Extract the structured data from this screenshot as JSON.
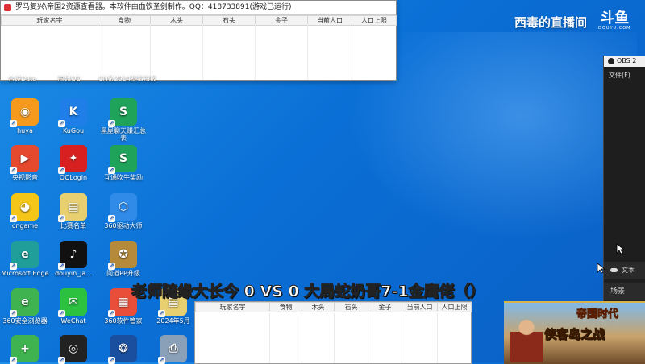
{
  "top_window": {
    "title": "罗马复兴\\帝国2资源查看器。本软件由血饮圣剑制作。QQ：418733891(游戏已运行)",
    "columns": [
      "玩家名字",
      "食物",
      "木头",
      "石头",
      "金子",
      "当前人口",
      "人口上限"
    ]
  },
  "desktop": {
    "partial_labels": [
      "合设Data",
      "腾讯QQ",
      "CN帝2024赛事海报"
    ],
    "icons": [
      {
        "label": "huya",
        "icon": "huya-icon",
        "color": "#f59a1c",
        "glyph": "◉"
      },
      {
        "label": "KuGou",
        "icon": "kugou-icon",
        "color": "#1f7ee8",
        "glyph": "K"
      },
      {
        "label": "黑屋聊天赚汇总表",
        "icon": "spreadsheet-icon",
        "color": "#1fa35a",
        "glyph": "S"
      },
      {
        "label": "央视影音",
        "icon": "cctv-player-icon",
        "color": "#e64a2e",
        "glyph": "▶"
      },
      {
        "label": "QQLogin",
        "icon": "qq-login-icon",
        "color": "#d82020",
        "glyph": "✦"
      },
      {
        "label": "互通吹牛奖励",
        "icon": "spreadsheet-icon",
        "color": "#1fa35a",
        "glyph": "S"
      },
      {
        "label": "cngame",
        "icon": "cngame-icon",
        "color": "#f5c518",
        "glyph": "◕"
      },
      {
        "label": "比赛名单",
        "icon": "document-icon",
        "color": "#e8d070",
        "glyph": "▤"
      },
      {
        "label": "360驱动大师",
        "icon": "driver-master-icon",
        "color": "#2f8ae8",
        "glyph": "⬡"
      },
      {
        "label": "Microsoft Edge",
        "icon": "edge-icon",
        "color": "#1f9e9a",
        "glyph": "e"
      },
      {
        "label": "douyin_ja...",
        "icon": "douyin-icon",
        "color": "#111111",
        "glyph": "♪"
      },
      {
        "label": "问道PP升级",
        "icon": "game-icon",
        "color": "#b58a3a",
        "glyph": "✪"
      },
      {
        "label": "360安全浏览器",
        "icon": "browser-360-icon",
        "color": "#3fb34f",
        "glyph": "e"
      },
      {
        "label": "WeChat",
        "icon": "wechat-icon",
        "color": "#2dc140",
        "glyph": "✉"
      },
      {
        "label": "360软件管家",
        "icon": "software-manager-icon",
        "color": "#e84e3a",
        "glyph": "▦"
      },
      {
        "label": "2024年5月",
        "icon": "document-icon",
        "color": "#e8d070",
        "glyph": "▤"
      },
      {
        "label": "",
        "icon": "plus-icon",
        "color": "#3fb34f",
        "glyph": "+"
      },
      {
        "label": "",
        "icon": "obs-icon",
        "color": "#222222",
        "glyph": "◎"
      },
      {
        "label": "",
        "icon": "film-reel-icon",
        "color": "#1a4fa0",
        "glyph": "❂"
      },
      {
        "label": "",
        "icon": "printer-icon",
        "color": "#8aa0b8",
        "glyph": "⎙"
      }
    ]
  },
  "watermark": {
    "text": "西毒的直播间",
    "logo_big": "斗鱼",
    "logo_small": "DOUYU.COM"
  },
  "obs": {
    "title": "OBS 2",
    "menu_file": "文件(F)",
    "dock_label": "文本",
    "scenes_label": "场景"
  },
  "caption": "老师随缘大长今 0 VS 0 大局蛇奶哥7-1金鹰佬（）",
  "bottom_window": {
    "columns": [
      "玩家名字",
      "食物",
      "木头",
      "石头",
      "金子",
      "当前人口",
      "人口上限"
    ]
  },
  "game_ad": {
    "logo": "帝国时代",
    "subtitle": "侠客岛之战"
  }
}
